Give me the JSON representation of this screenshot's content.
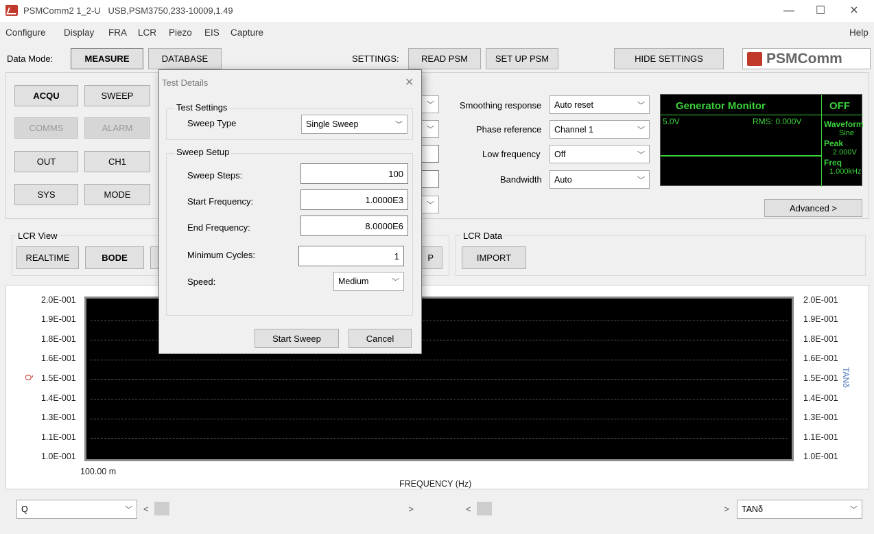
{
  "window": {
    "title": "PSMComm2 1_2-U   USB,PSM3750,233-10009,1.49",
    "minimize": "—",
    "maximize": "☐",
    "close": "✕"
  },
  "menu": [
    "Configure",
    "Display",
    "FRA",
    "LCR",
    "Piezo",
    "EIS",
    "Capture"
  ],
  "menu_help": "Help",
  "toolbar": {
    "data_mode_label": "Data Mode:",
    "measure": "MEASURE",
    "database": "DATABASE",
    "settings_label": "SETTINGS:",
    "read_psm": "READ PSM",
    "set_up_psm": "SET UP PSM",
    "hide_settings": "HIDE SETTINGS",
    "logo": "PSMComm"
  },
  "left_buttons": {
    "acqu": "ACQU",
    "sweep": "SWEEP",
    "comms": "COMMS",
    "alarm": "ALARM",
    "out": "OUT",
    "ch1": "CH1",
    "sys": "SYS",
    "mode": "MODE"
  },
  "settings": {
    "smoothing_label": "Smoothing response",
    "smoothing_value": "Auto reset",
    "phase_label": "Phase reference",
    "phase_value": "Channel 1",
    "lowfreq_label": "Low frequency",
    "lowfreq_value": "Off",
    "bandwidth_label": "Bandwidth",
    "bandwidth_value": "Auto",
    "advanced": "Advanced >"
  },
  "generator": {
    "title": "Generator Monitor",
    "status": "OFF",
    "voltage": "5.0V",
    "rms": "RMS: 0.000V",
    "waveform_label": "Waveform",
    "waveform_value": "Sine",
    "peak_label": "Peak",
    "peak_value": "2.000V",
    "freq_label": "Freq",
    "freq_value": "1.000kHz"
  },
  "lcr_view": {
    "title": "LCR View",
    "realtime": "REALTIME",
    "bode": "BODE",
    "partial_button": "P"
  },
  "lcr_data": {
    "title": "LCR Data",
    "import": "IMPORT"
  },
  "dialog": {
    "title": "Test Details",
    "close": "✕",
    "test_settings_title": "Test Settings",
    "sweep_type_label": "Sweep Type",
    "sweep_type_value": "Single Sweep",
    "sweep_setup_title": "Sweep Setup",
    "steps_label": "Sweep Steps:",
    "steps_value": "100",
    "start_label": "Start Frequency:",
    "start_value": "1.0000E3",
    "end_label": "End Frequency:",
    "end_value": "8.0000E6",
    "cycles_label": "Minimum Cycles:",
    "cycles_value": "1",
    "speed_label": "Speed:",
    "speed_value": "Medium",
    "start_sweep": "Start Sweep",
    "cancel": "Cancel"
  },
  "chart": {
    "left_ticks": [
      "2.0E-001",
      "1.9E-001",
      "1.8E-001",
      "1.6E-001",
      "1.5E-001",
      "1.4E-001",
      "1.3E-001",
      "1.1E-001",
      "1.0E-001"
    ],
    "right_ticks": [
      "2.0E-001",
      "1.9E-001",
      "1.8E-001",
      "1.6E-001",
      "1.5E-001",
      "1.4E-001",
      "1.3E-001",
      "1.1E-001",
      "1.0E-001"
    ],
    "left_axis_symbol": "Q",
    "right_axis_label": "TANδ",
    "x_tick": "100.00 m",
    "x_label": "FREQUENCY (Hz)"
  },
  "bottom": {
    "left_select": "Q",
    "right_select": "TANδ"
  },
  "colors": {
    "accent_green": "#3bd23b",
    "logo_red": "#c0392b",
    "right_axis_blue": "#4a76b8"
  }
}
